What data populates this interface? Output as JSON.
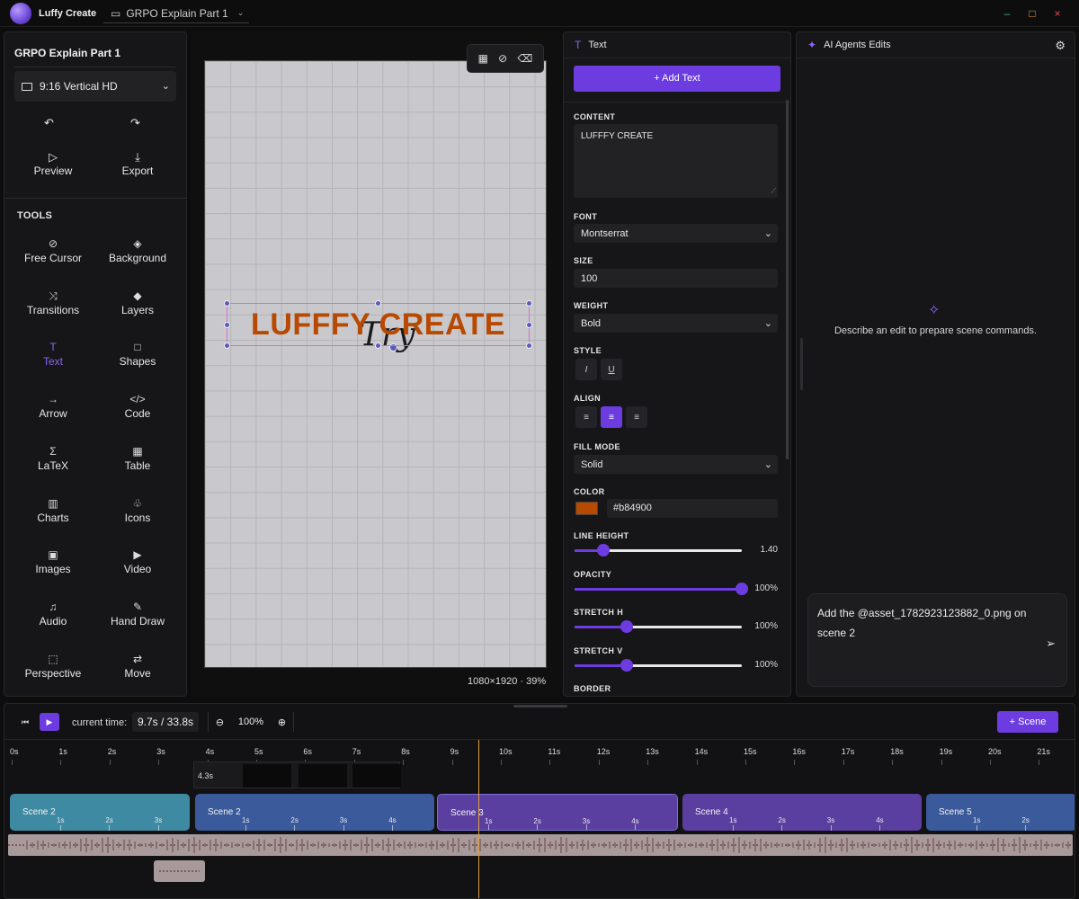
{
  "titlebar": {
    "app_name": "Luffy Create",
    "project_tab": "GRPO Explain Part 1",
    "minimize": "–",
    "maximize": "□",
    "close": "×"
  },
  "left": {
    "project_title": "GRPO Explain Part 1",
    "aspect": "9:16 Vertical HD",
    "undo_icon": "↶",
    "redo_icon": "↷",
    "preview_label": "Preview",
    "export_label": "Export",
    "tools_label": "TOOLS",
    "tools": [
      {
        "label": "Free Cursor",
        "icon": "⊘"
      },
      {
        "label": "Background",
        "icon": "◈"
      },
      {
        "label": "Transitions",
        "icon": "⤨"
      },
      {
        "label": "Layers",
        "icon": "◆"
      },
      {
        "label": "Text",
        "icon": "T"
      },
      {
        "label": "Shapes",
        "icon": "□"
      },
      {
        "label": "Arrow",
        "icon": "→"
      },
      {
        "label": "Code",
        "icon": "</>"
      },
      {
        "label": "LaTeX",
        "icon": "Σ"
      },
      {
        "label": "Table",
        "icon": "▦"
      },
      {
        "label": "Charts",
        "icon": "▥"
      },
      {
        "label": "Icons",
        "icon": "♧"
      },
      {
        "label": "Images",
        "icon": "▣"
      },
      {
        "label": "Video",
        "icon": "▶"
      },
      {
        "label": "Audio",
        "icon": "♫"
      },
      {
        "label": "Hand Draw",
        "icon": "✎"
      },
      {
        "label": "Perspective",
        "icon": "⬚"
      },
      {
        "label": "Move",
        "icon": "⇄"
      }
    ]
  },
  "canvas": {
    "try_text": "Try",
    "main_text": "LUFFFY CREATE",
    "text_color": "#b84900",
    "info": "1080×1920 · 39%"
  },
  "text_panel": {
    "title": "Text",
    "add_text": "+ Add Text",
    "content_label": "CONTENT",
    "content_value": "LUFFFY CREATE",
    "font_label": "FONT",
    "font_value": "Montserrat",
    "size_label": "SIZE",
    "size_value": "100",
    "weight_label": "WEIGHT",
    "weight_value": "Bold",
    "style_label": "STYLE",
    "align_label": "ALIGN",
    "fill_mode_label": "FILL MODE",
    "fill_mode_value": "Solid",
    "color_label": "COLOR",
    "color_value": "#b84900",
    "line_height_label": "LINE HEIGHT",
    "line_height_value": "1.40",
    "line_height_level": 0.17,
    "opacity_label": "OPACITY",
    "opacity_value": "100%",
    "opacity_level": 1.0,
    "stretch_h_label": "STRETCH H",
    "stretch_h_value": "100%",
    "stretch_h_level": 0.31,
    "stretch_v_label": "STRETCH V",
    "stretch_v_value": "100%",
    "stretch_v_level": 0.31,
    "border_label": "BORDER"
  },
  "ai_panel": {
    "title": "AI Agents Edits",
    "hint": "Describe an edit to prepare scene commands.",
    "prompt": "Add the @asset_1782923123882_0.png on scene 2"
  },
  "timeline": {
    "current_time_label": "current time:",
    "current_time": "9.7s / 33.8s",
    "zoom": "100%",
    "add_scene": "+ Scene",
    "ruler": [
      "0s",
      "1s",
      "2s",
      "3s",
      "4s",
      "5s",
      "6s",
      "7s",
      "8s",
      "9s",
      "10s",
      "11s",
      "12s",
      "13s",
      "14s",
      "15s",
      "16s",
      "17s",
      "18s",
      "19s",
      "20s",
      "21s"
    ],
    "clip_label": "4.3s",
    "scenes": [
      {
        "name": "Scene 2",
        "ticks": [
          "1s",
          "2s",
          "3s"
        ],
        "color": "#3f8aa3"
      },
      {
        "name": "Scene 2",
        "ticks": [
          "1s",
          "2s",
          "3s",
          "4s"
        ],
        "color": "#3a5a9c"
      },
      {
        "name": "Scene 3",
        "ticks": [
          "1s",
          "2s",
          "3s",
          "4s"
        ],
        "color": "#5a3fa0"
      },
      {
        "name": "Scene 4",
        "ticks": [
          "1s",
          "2s",
          "3s",
          "4s"
        ],
        "color": "#5a3fa0"
      },
      {
        "name": "Scene 5",
        "ticks": [
          "1s",
          "2s"
        ],
        "color": "#3a5a9c"
      }
    ]
  }
}
